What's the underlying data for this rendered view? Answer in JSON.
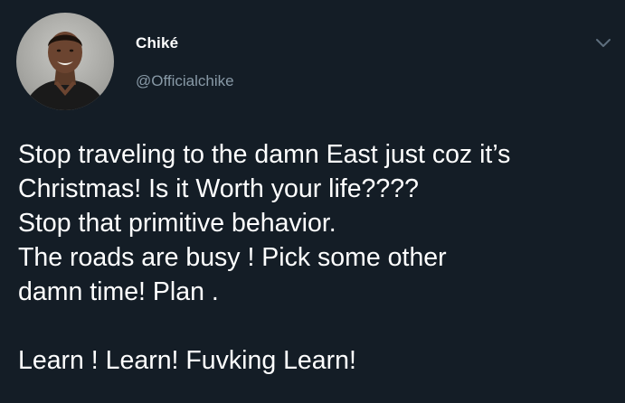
{
  "tweet": {
    "display_name": "Chiké",
    "handle": "@Officialchike",
    "avatar_icon": "profile-photo",
    "menu_icon": "chevron-down-icon",
    "lines": [
      "Stop traveling to the damn East just coz it’s",
      "Christmas! Is it Worth your life????",
      "Stop that primitive behavior.",
      "The roads are busy ! Pick some other",
      "damn time! Plan .",
      "",
      "Learn ! Learn! Fuvking Learn!"
    ]
  },
  "colors": {
    "background": "#141d26",
    "text": "#ffffff",
    "secondary_text": "#8899a6"
  }
}
